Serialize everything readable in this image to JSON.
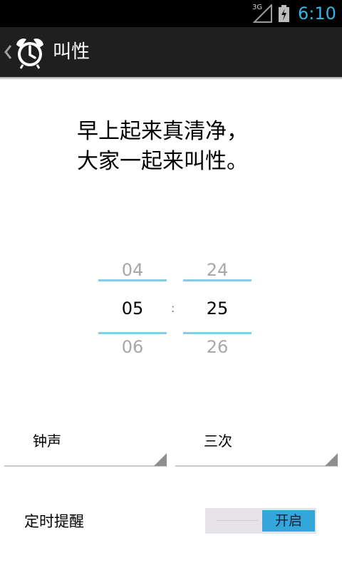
{
  "status_bar": {
    "network_type": "3G",
    "time": "6:10",
    "colors": {
      "background": "#000000",
      "time": "#33b5e5"
    },
    "icons": [
      "signal-icon",
      "battery-charging-icon"
    ]
  },
  "action_bar": {
    "title": "叫性",
    "icons": [
      "back-chevron-icon",
      "alarm-clock-icon"
    ],
    "background": "#1f1f1f"
  },
  "slogan": {
    "line1": "早上起来真清净，",
    "line2": "大家一起来叫性。"
  },
  "time_picker": {
    "hour": {
      "prev": "04",
      "current": "05",
      "next": "06"
    },
    "separator": ":",
    "minute": {
      "prev": "24",
      "current": "25",
      "next": "26"
    },
    "accent": "#88cce8"
  },
  "options": {
    "sound": {
      "value": "钟声"
    },
    "repeat": {
      "value": "三次"
    }
  },
  "reminder": {
    "label": "定时提醒",
    "toggle_text": "开启",
    "toggle_on": true,
    "accent": "#33a7d9"
  }
}
